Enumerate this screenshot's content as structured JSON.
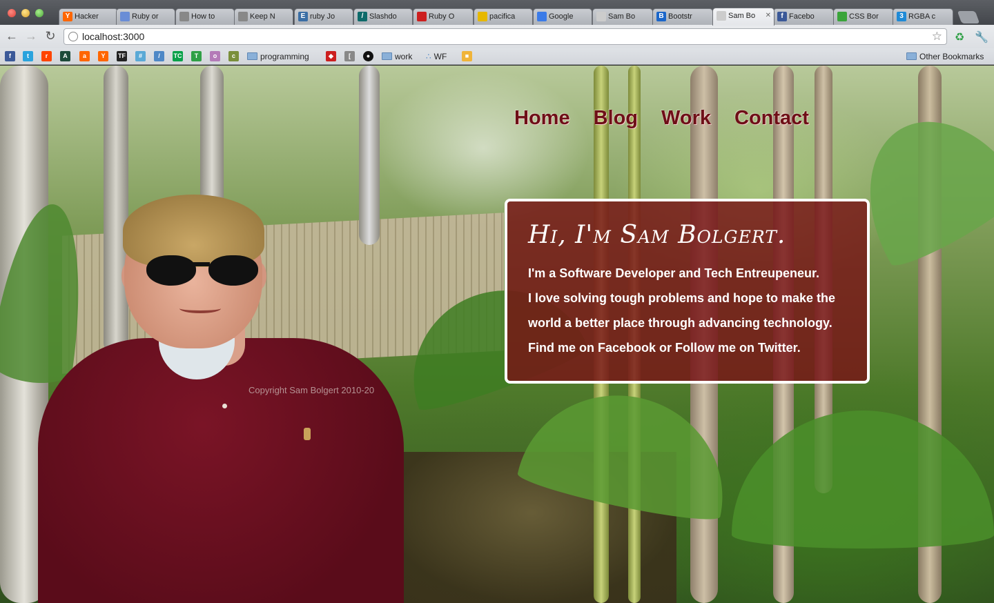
{
  "browser": {
    "tabs": [
      {
        "title": "Hacker",
        "favicon_color": "#ff6600",
        "favicon_glyph": "Y",
        "icon": "hacker-news-icon"
      },
      {
        "title": "Ruby or",
        "favicon_color": "#6a8dd6",
        "favicon_glyph": "",
        "icon": "ruby-forum-icon"
      },
      {
        "title": "How to",
        "favicon_color": "#888888",
        "favicon_glyph": "",
        "icon": "page-icon"
      },
      {
        "title": "Keep N",
        "favicon_color": "#888888",
        "favicon_glyph": "",
        "icon": "page-icon"
      },
      {
        "title": "ruby Jo",
        "favicon_color": "#3a6ea5",
        "favicon_glyph": "E",
        "icon": "jobs-icon"
      },
      {
        "title": "Slashdo",
        "favicon_color": "#0d6a6a",
        "favicon_glyph": "/",
        "icon": "slashdot-icon"
      },
      {
        "title": "Ruby O",
        "favicon_color": "#cc1f1f",
        "favicon_glyph": "",
        "icon": "ruby-icon"
      },
      {
        "title": "pacifica",
        "favicon_color": "#e6b800",
        "favicon_glyph": "",
        "icon": "pacifica-icon"
      },
      {
        "title": "Google",
        "favicon_color": "#3b7be8",
        "favicon_glyph": "",
        "icon": "google-icon"
      },
      {
        "title": "Sam Bo",
        "favicon_color": "#cccccc",
        "favicon_glyph": "",
        "icon": "globe-icon"
      },
      {
        "title": "Bootstr",
        "favicon_color": "#1b66c9",
        "favicon_glyph": "B",
        "icon": "bootstrap-icon"
      },
      {
        "title": "Sam Bo",
        "favicon_color": "#cccccc",
        "favicon_glyph": "",
        "icon": "globe-icon",
        "active": true
      },
      {
        "title": "Facebo",
        "favicon_color": "#3b5998",
        "favicon_glyph": "f",
        "icon": "facebook-icon"
      },
      {
        "title": "CSS Bor",
        "favicon_color": "#3aa43a",
        "favicon_glyph": "",
        "icon": "css-icon"
      },
      {
        "title": "RGBA c",
        "favicon_color": "#1f8ad6",
        "favicon_glyph": "3",
        "icon": "css3-icon"
      }
    ],
    "address": "localhost:3000",
    "bookmarks": {
      "icons": [
        {
          "name": "facebook-icon",
          "color": "#3b5998",
          "glyph": "f"
        },
        {
          "name": "twitter-icon",
          "color": "#2aa3dd",
          "glyph": "t"
        },
        {
          "name": "reddit-icon",
          "color": "#ff4500",
          "glyph": "r"
        },
        {
          "name": "arstechnica-icon",
          "color": "#1d4a3a",
          "glyph": "A"
        },
        {
          "name": "ars-icon",
          "color": "#ff6600",
          "glyph": "a"
        },
        {
          "name": "ycombinator-icon",
          "color": "#ff6600",
          "glyph": "Y"
        },
        {
          "name": "techfreak-icon",
          "color": "#222222",
          "glyph": "TF"
        },
        {
          "name": "grid-icon",
          "color": "#5aa9d6",
          "glyph": "#"
        },
        {
          "name": "edit-icon",
          "color": "#4f88c6",
          "glyph": "/"
        },
        {
          "name": "techcrunch-icon",
          "color": "#0aa14a",
          "glyph": "TC"
        },
        {
          "name": "t-icon",
          "color": "#2fa046",
          "glyph": "T"
        },
        {
          "name": "clock-icon",
          "color": "#b47ab8",
          "glyph": "o"
        },
        {
          "name": "cat-icon",
          "color": "#7a8f3a",
          "glyph": "c"
        }
      ],
      "folders": [
        "programming",
        "work",
        "WF"
      ],
      "other": "Other Bookmarks"
    }
  },
  "site": {
    "nav": [
      "Home",
      "Blog",
      "Work",
      "Contact"
    ],
    "hero": {
      "title": "Hi, I'm Sam Bolgert.",
      "line1": "I'm a Software Developer and Tech Entreupeneur.",
      "line2": "I love solving tough problems and hope to make the",
      "line3": "world a better place through advancing technology.",
      "line4": "Find me on Facebook or Follow me on Twitter."
    },
    "copyright": "Copyright Sam Bolgert 2010-20"
  },
  "colors": {
    "nav_text": "#6e0f17",
    "card_bg": "rgba(120,20,22,0.82)",
    "card_border": "#ffffff"
  }
}
